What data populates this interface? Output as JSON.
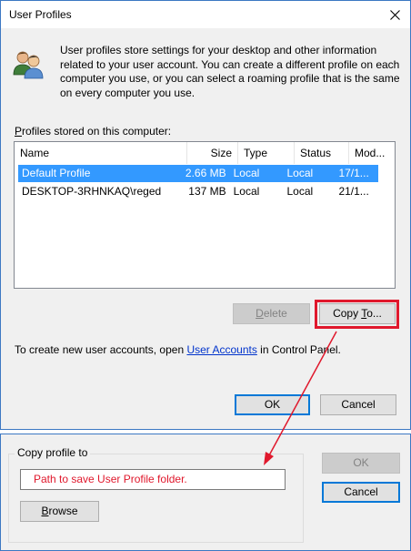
{
  "window": {
    "title": "User Profiles",
    "info_text": "User profiles store settings for your desktop and other information related to your user account. You can create a different profile on each computer you use, or you can select a roaming profile that is the same on every computer you use.",
    "profiles_label_ak": "P",
    "profiles_label_rest": "rofiles stored on this computer:",
    "columns": [
      "Name",
      "Size",
      "Type",
      "Status",
      "Mod..."
    ],
    "rows": [
      {
        "name": "Default Profile",
        "size": "2.66 MB",
        "type": "Local",
        "status": "Local",
        "modified": "17/1...",
        "selected": true
      },
      {
        "name": "DESKTOP-3RHNKAQ\\reged",
        "size": "137 MB",
        "type": "Local",
        "status": "Local",
        "modified": "21/1...",
        "selected": false
      }
    ],
    "delete_ak": "D",
    "delete_rest": "elete",
    "copy_to_pre": "Copy ",
    "copy_to_ak": "T",
    "copy_to_post": "o...",
    "create_prefix": "To create new user accounts, open ",
    "create_link": "User Accounts",
    "create_suffix": " in Control Panel.",
    "ok_label": "OK",
    "cancel_label": "Cancel"
  },
  "copy_dialog": {
    "group_title": "Copy profile to",
    "path_text": "Path to save User Profile folder.",
    "browse_ak": "B",
    "browse_rest": "rowse",
    "ok_label": "OK",
    "cancel_label": "Cancel"
  },
  "colors": {
    "selection": "#3399ff",
    "annotation_red": "#e0182c",
    "window_border": "#3c78c3",
    "link": "#0033cc"
  }
}
